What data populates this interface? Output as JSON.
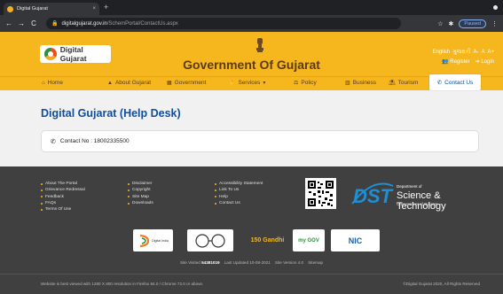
{
  "browser": {
    "tab_title": "Digital Gujarat",
    "tab_close": "×",
    "new_tab": "+",
    "url_host": "digitalgujarat.gov.in",
    "url_path": "/SchemPortal/ContactUs.aspx",
    "paused_label": "Paused",
    "nav_back": "←",
    "nav_forward": "→",
    "nav_reload": "C",
    "lock": "🔒"
  },
  "header": {
    "logo_text": "Digital Gujarat",
    "title": "Government Of Gujarat",
    "lang_english": "English",
    "lang_gujarati": "ગુજરાતી",
    "font_small": "A-",
    "font_normal": "A",
    "font_large": "A+",
    "register": "Register",
    "login": "Login"
  },
  "menu": {
    "items": [
      {
        "label": "Home",
        "icon": "home-icon"
      },
      {
        "label": "About Gujarat",
        "icon": "bell-icon"
      },
      {
        "label": "Government",
        "icon": "building-icon"
      },
      {
        "label": "Services",
        "icon": "hands-icon"
      },
      {
        "label": "Policy",
        "icon": "balance-icon"
      },
      {
        "label": "Business",
        "icon": "chart-icon"
      },
      {
        "label": "Tourism",
        "icon": "tourism-icon"
      }
    ],
    "contact_label": "Contact Us"
  },
  "main": {
    "title": "Digital Gujarat (Help Desk)",
    "contact_text": "Contact No : 18002335500"
  },
  "footer": {
    "col1": [
      "About The Portal",
      "Grievance Redressal",
      "Feedback",
      "FAQs",
      "Terms Of Use"
    ],
    "col2": [
      "Disclaimer",
      "Copyright",
      "Site Map",
      "Downloads"
    ],
    "col3": [
      "Accessibility Statement",
      "Link To Us",
      "Help",
      "Contact Us"
    ],
    "dst_dept": "Department of",
    "dst_letters": "DST",
    "dst_name": "Science & Technology",
    "dst_sub": "Government of Gujarat",
    "partners": [
      "Digital India",
      "Swachh Bharat",
      "150 Gandhi",
      "my GOV",
      "NIC"
    ],
    "site_visited_label": "Site Visited",
    "site_visited_count": "54381019",
    "last_updated": "Last Updated 10-08-2021",
    "site_version": "Site Version 4.0",
    "sitemap": "Sitemap",
    "best_view": "Website is best viewed with 1280 X 800 resolution in Firefox 84.0 / Chrome 72.0 or above.",
    "copyright": "©Digital Gujarat 2020, All Rights Reserved"
  },
  "colors": {
    "brand": "#f5b71d",
    "link_blue": "#0c4fa3",
    "footer_bg": "#404040"
  }
}
